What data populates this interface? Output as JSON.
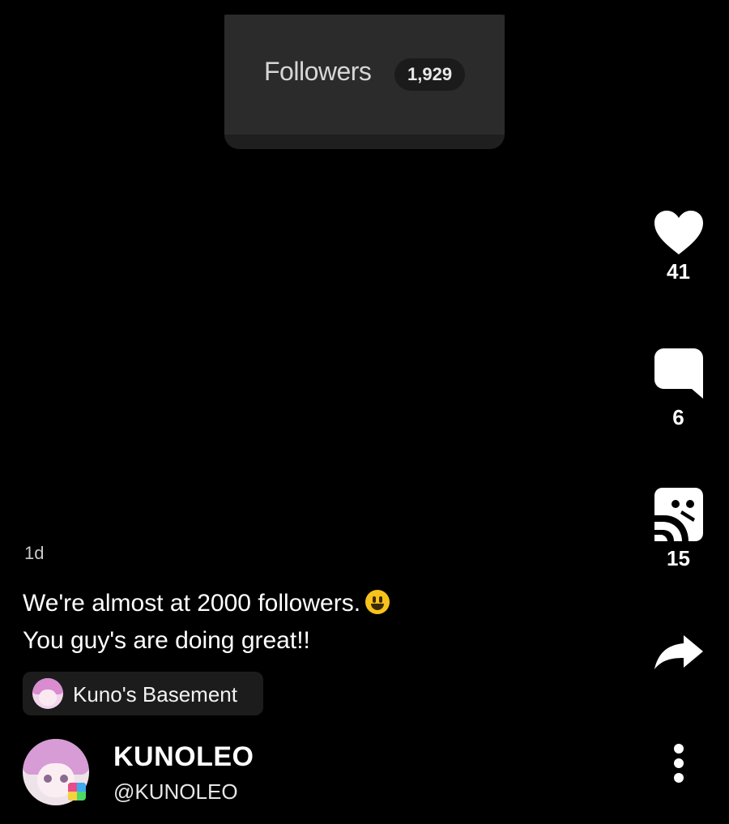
{
  "post_image": {
    "followers_label": "Followers",
    "followers_count": "1,929"
  },
  "actions": {
    "like_count": "41",
    "comment_count": "6",
    "repost_count": "15"
  },
  "post": {
    "timestamp": "1d",
    "caption_line1": "We're almost at 2000 followers.",
    "caption_line2": "You guy's are doing great!!",
    "emoji_icon": "grinning-face-emoji"
  },
  "community": {
    "name": "Kuno's Basement"
  },
  "author": {
    "display_name": "KUNOLEO",
    "handle": "@KUNOLEO"
  },
  "colors": {
    "background": "#000000",
    "text": "#ffffff"
  }
}
